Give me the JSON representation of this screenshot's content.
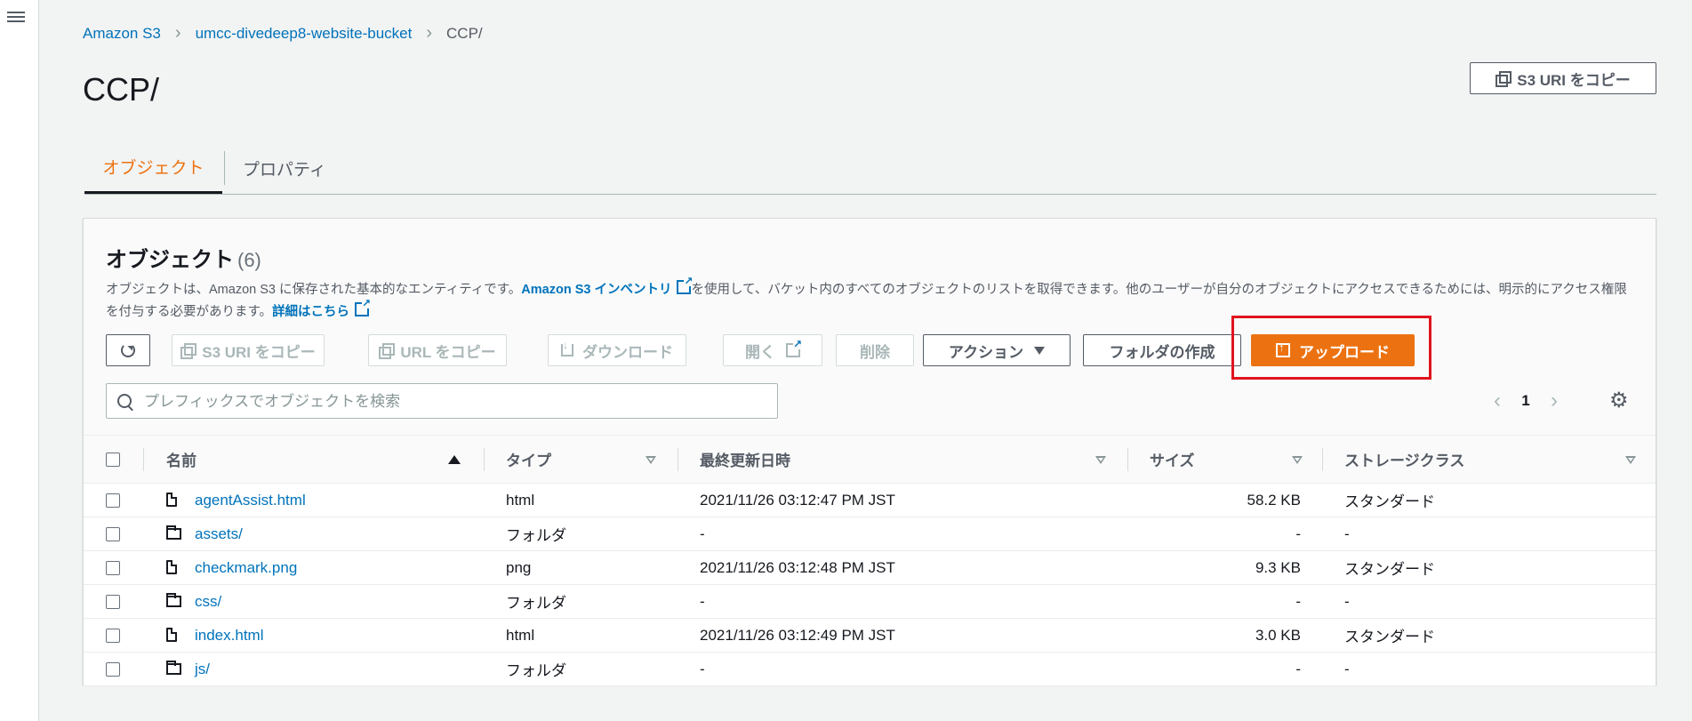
{
  "breadcrumb": {
    "items": [
      "Amazon S3",
      "umcc-divedeep8-website-bucket"
    ],
    "current": "CCP/"
  },
  "page": {
    "title": "CCP/",
    "copy_uri_label": "S3 URI をコピー"
  },
  "tabs": [
    {
      "label": "オブジェクト",
      "active": true
    },
    {
      "label": "プロパティ",
      "active": false
    }
  ],
  "objects_panel": {
    "title": "オブジェクト",
    "count": "(6)",
    "description": {
      "part1": "オブジェクトは、Amazon S3 に保存された基本的なエンティティです。",
      "link1": "Amazon S3 インベントリ",
      "part2": "を使用して、バケット内のすべてのオブジェクトのリストを取得できます。他のユーザーが自分のオブジェクトにアクセスできるためには、明示的にアクセス権限を付与する必要があります。",
      "link2": "詳細はこちら"
    }
  },
  "toolbar": {
    "copy_s3_uri": "S3 URI をコピー",
    "copy_url": "URL をコピー",
    "download": "ダウンロード",
    "open": "開く",
    "delete": "削除",
    "actions": "アクション",
    "create_folder": "フォルダの作成",
    "upload": "アップロード"
  },
  "search": {
    "placeholder": "プレフィックスでオブジェクトを検索"
  },
  "pagination": {
    "current_page": "1"
  },
  "table": {
    "columns": [
      "名前",
      "タイプ",
      "最終更新日時",
      "サイズ",
      "ストレージクラス"
    ],
    "rows": [
      {
        "name": "agentAssist.html",
        "kind": "file",
        "type": "html",
        "modified": "2021/11/26 03:12:47 PM JST",
        "size": "58.2 KB",
        "storage": "スタンダード"
      },
      {
        "name": "assets/",
        "kind": "folder",
        "type": "フォルダ",
        "modified": "-",
        "size": "-",
        "storage": "-"
      },
      {
        "name": "checkmark.png",
        "kind": "file",
        "type": "png",
        "modified": "2021/11/26 03:12:48 PM JST",
        "size": "9.3 KB",
        "storage": "スタンダード"
      },
      {
        "name": "css/",
        "kind": "folder",
        "type": "フォルダ",
        "modified": "-",
        "size": "-",
        "storage": "-"
      },
      {
        "name": "index.html",
        "kind": "file",
        "type": "html",
        "modified": "2021/11/26 03:12:49 PM JST",
        "size": "3.0 KB",
        "storage": "スタンダード"
      },
      {
        "name": "js/",
        "kind": "folder",
        "type": "フォルダ",
        "modified": "-",
        "size": "-",
        "storage": "-"
      }
    ]
  },
  "colors": {
    "accent": "#ec7211",
    "link": "#0073bb",
    "highlight": "#e0141e"
  }
}
